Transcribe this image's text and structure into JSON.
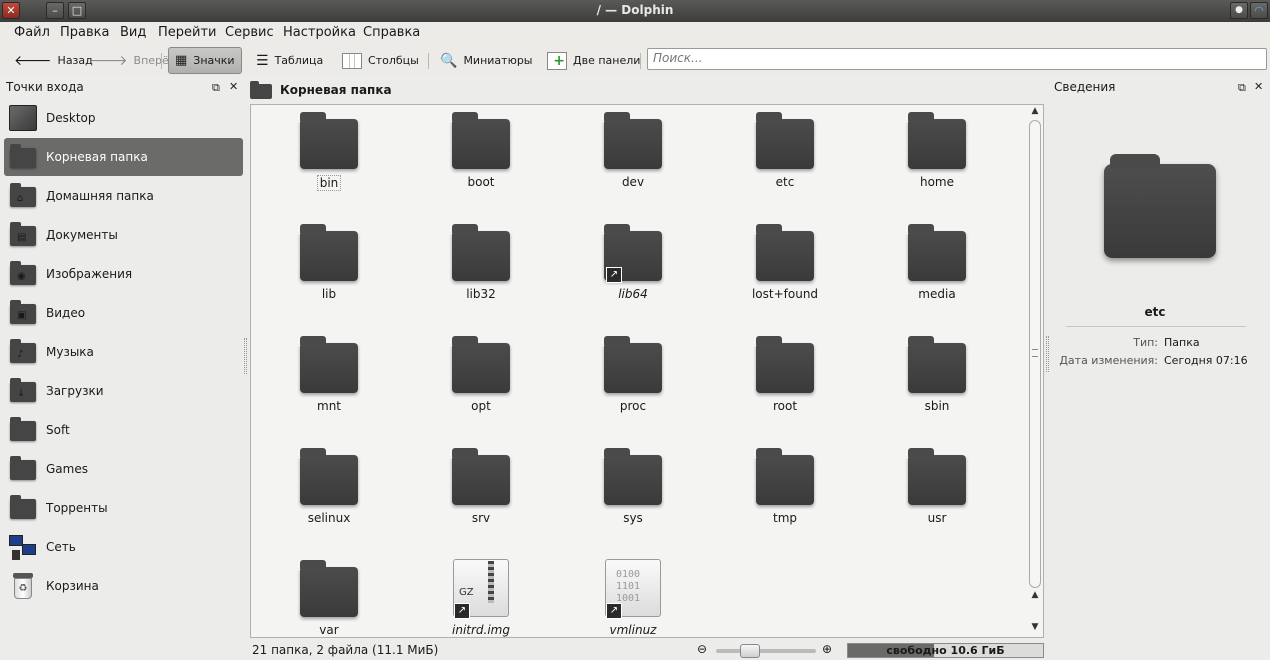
{
  "window": {
    "title": "/ — Dolphin"
  },
  "menu": [
    "Файл",
    "Правка",
    "Вид",
    "Перейти",
    "Сервис",
    "Настройка",
    "Справка"
  ],
  "toolbar": {
    "back": "Назад",
    "forward": "Вперёд",
    "icons": "Значки",
    "table": "Таблица",
    "columns": "Столбцы",
    "thumbnails": "Миниатюры",
    "split": "Две панели",
    "search_placeholder": "Поиск..."
  },
  "places": {
    "title": "Точки входа",
    "items": [
      {
        "label": "Desktop"
      },
      {
        "label": "Корневая папка"
      },
      {
        "label": "Домашняя папка"
      },
      {
        "label": "Документы"
      },
      {
        "label": "Изображения"
      },
      {
        "label": "Видео"
      },
      {
        "label": "Музыка"
      },
      {
        "label": "Загрузки"
      },
      {
        "label": "Soft"
      },
      {
        "label": "Games"
      },
      {
        "label": "Торренты"
      },
      {
        "label": "Сеть"
      },
      {
        "label": "Корзина"
      }
    ]
  },
  "breadcrumb": {
    "label": "Корневая папка"
  },
  "files": [
    {
      "name": "bin"
    },
    {
      "name": "boot"
    },
    {
      "name": "dev"
    },
    {
      "name": "etc"
    },
    {
      "name": "home"
    },
    {
      "name": "lib"
    },
    {
      "name": "lib32"
    },
    {
      "name": "lib64"
    },
    {
      "name": "lost+found"
    },
    {
      "name": "media"
    },
    {
      "name": "mnt"
    },
    {
      "name": "opt"
    },
    {
      "name": "proc"
    },
    {
      "name": "root"
    },
    {
      "name": "sbin"
    },
    {
      "name": "selinux"
    },
    {
      "name": "srv"
    },
    {
      "name": "sys"
    },
    {
      "name": "tmp"
    },
    {
      "name": "usr"
    },
    {
      "name": "var"
    },
    {
      "name": "initrd.img"
    },
    {
      "name": "vmlinuz"
    }
  ],
  "file_icons": {
    "gz_label": "GZ",
    "bin_lines": [
      "0100",
      "1101",
      "1001"
    ]
  },
  "status": {
    "summary": "21 папка, 2 файла (11.1 МиБ)",
    "free_space": "свободно 10.6 ГиБ",
    "used_fraction": 0.44,
    "zoom_fraction": 0.3
  },
  "info": {
    "title": "Сведения",
    "name": "etc",
    "type_label": "Тип:",
    "type_value": "Папка",
    "modified_label": "Дата изменения:",
    "modified_value": "Сегодня 07:16"
  }
}
